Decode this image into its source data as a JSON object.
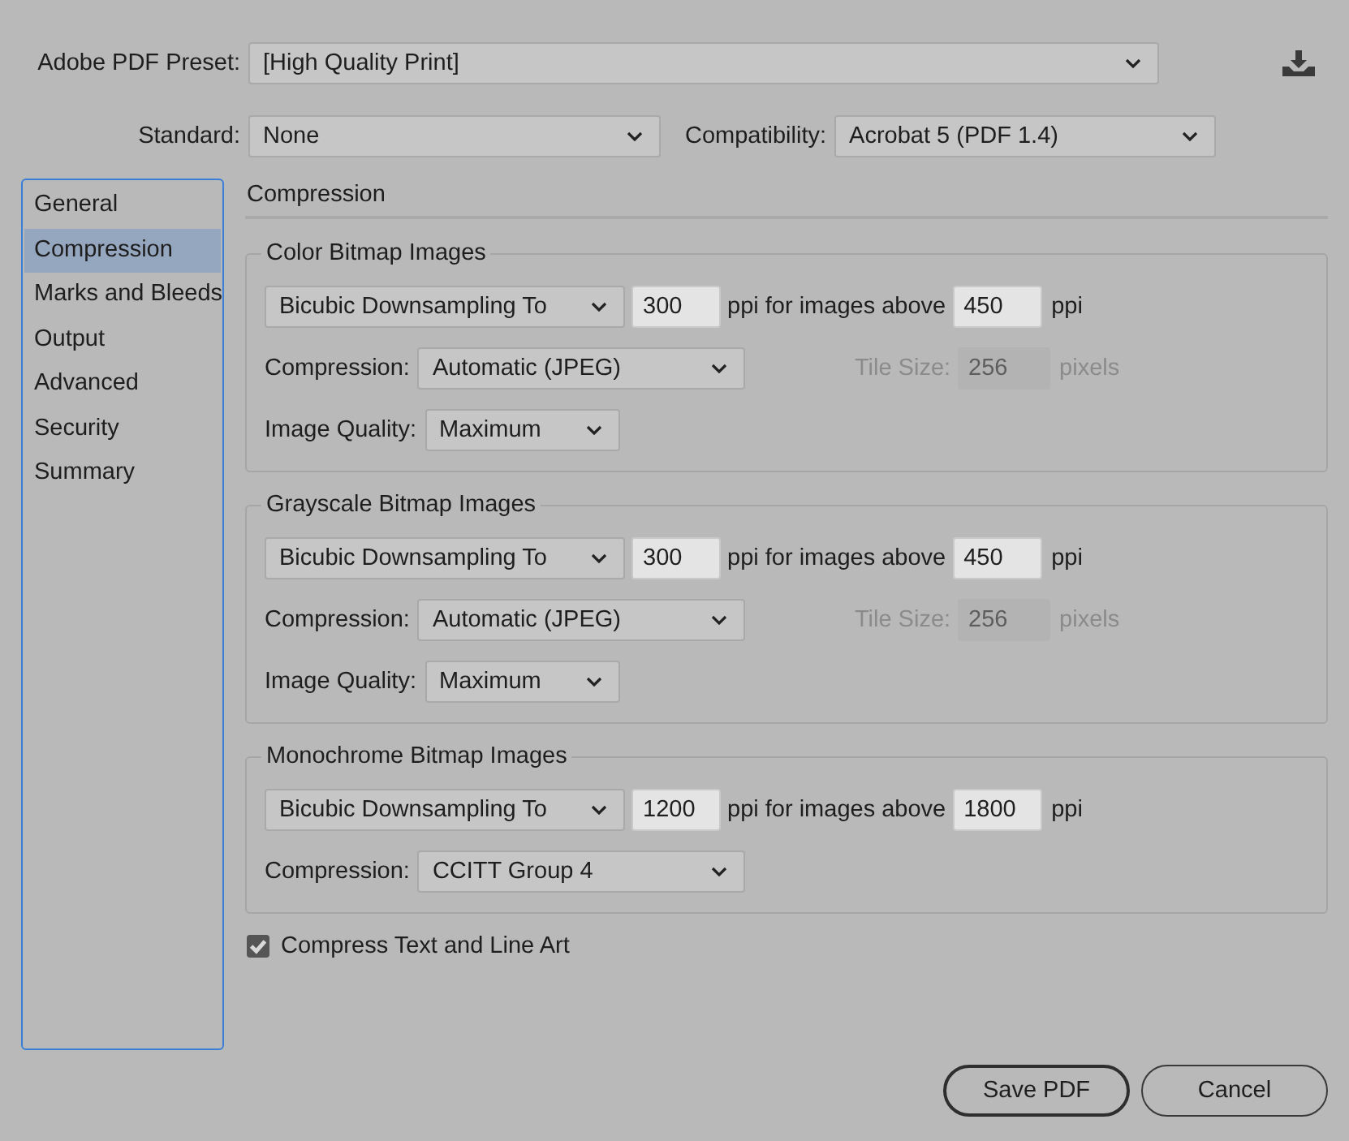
{
  "preset": {
    "label": "Adobe PDF Preset:",
    "value": "[High Quality Print]"
  },
  "standard": {
    "label": "Standard:",
    "value": "None"
  },
  "compatibility": {
    "label": "Compatibility:",
    "value": "Acrobat 5 (PDF 1.4)"
  },
  "sidebar": {
    "items": [
      {
        "label": "General",
        "selected": false
      },
      {
        "label": "Compression",
        "selected": true
      },
      {
        "label": "Marks and Bleeds",
        "selected": false
      },
      {
        "label": "Output",
        "selected": false
      },
      {
        "label": "Advanced",
        "selected": false
      },
      {
        "label": "Security",
        "selected": false
      },
      {
        "label": "Summary",
        "selected": false
      }
    ]
  },
  "section_title": "Compression",
  "groups": [
    {
      "title": "Color Bitmap Images",
      "rows": [
        {
          "kind": "downsample",
          "method": "Bicubic Downsampling To",
          "resolution": "300",
          "connector": "ppi for images above",
          "threshold": "450",
          "unit": "ppi"
        },
        {
          "kind": "compression",
          "label": "Compression:",
          "value": "Automatic (JPEG)",
          "tile": {
            "label": "Tile Size:",
            "value": "256",
            "unit": "pixels",
            "disabled": true
          }
        },
        {
          "kind": "quality",
          "label": "Image Quality:",
          "value": "Maximum"
        }
      ]
    },
    {
      "title": "Grayscale Bitmap Images",
      "rows": [
        {
          "kind": "downsample",
          "method": "Bicubic Downsampling To",
          "resolution": "300",
          "connector": "ppi for images above",
          "threshold": "450",
          "unit": "ppi"
        },
        {
          "kind": "compression",
          "label": "Compression:",
          "value": "Automatic (JPEG)",
          "tile": {
            "label": "Tile Size:",
            "value": "256",
            "unit": "pixels",
            "disabled": true
          }
        },
        {
          "kind": "quality",
          "label": "Image Quality:",
          "value": "Maximum"
        }
      ]
    },
    {
      "title": "Monochrome Bitmap Images",
      "rows": [
        {
          "kind": "downsample",
          "method": "Bicubic Downsampling To",
          "resolution": "1200",
          "connector": "ppi for images above",
          "threshold": "1800",
          "unit": "ppi"
        },
        {
          "kind": "compression",
          "label": "Compression:",
          "value": "CCITT Group 4"
        }
      ]
    }
  ],
  "compress_text": {
    "label": "Compress Text and Line Art",
    "checked": true
  },
  "buttons": [
    {
      "label": "Save PDF",
      "primary": true
    },
    {
      "label": "Cancel",
      "primary": false
    }
  ]
}
